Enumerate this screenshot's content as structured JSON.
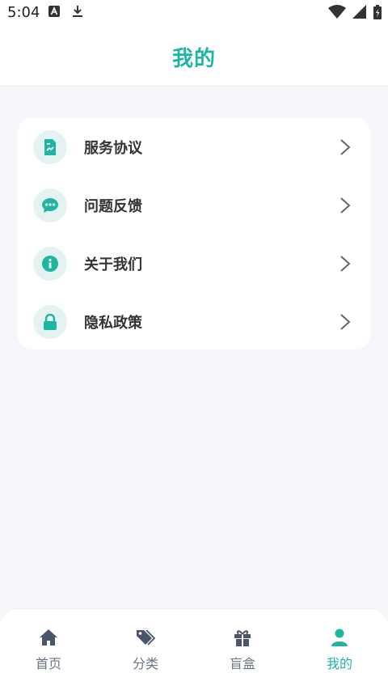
{
  "status_bar": {
    "time": "5:04",
    "left_icons": [
      "font-a-icon",
      "download-icon"
    ],
    "right_icons": [
      "wifi-icon",
      "signal-icon",
      "battery-icon"
    ]
  },
  "header": {
    "title": "我的"
  },
  "menu": {
    "items": [
      {
        "label": "服务协议",
        "icon": "document-icon"
      },
      {
        "label": "问题反馈",
        "icon": "chat-bubble-icon"
      },
      {
        "label": "关于我们",
        "icon": "info-icon"
      },
      {
        "label": "隐私政策",
        "icon": "lock-icon"
      }
    ]
  },
  "tabbar": {
    "tabs": [
      {
        "label": "首页",
        "icon": "home-icon",
        "active": false
      },
      {
        "label": "分类",
        "icon": "tags-icon",
        "active": false
      },
      {
        "label": "盲盒",
        "icon": "gift-icon",
        "active": false
      },
      {
        "label": "我的",
        "icon": "user-icon",
        "active": true
      }
    ]
  },
  "colors": {
    "accent": "#1fb5a3",
    "icon_bg": "#e3f3f1",
    "page_bg": "#f5f7fa",
    "tab_inactive": "#6a7486"
  }
}
